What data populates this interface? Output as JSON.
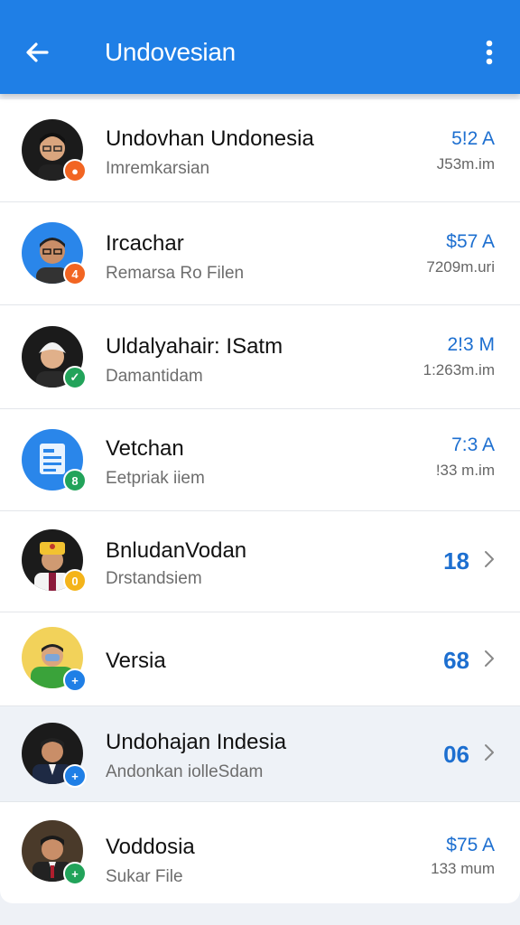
{
  "appbar": {
    "title": "Undovesian",
    "back_icon": "arrow-left-icon",
    "menu_icon": "more-vert-icon",
    "color": "#1f7fe6"
  },
  "items": [
    {
      "name": "Undovhan Undonesia",
      "subtitle": "Imremkarsian",
      "amount": "5!2 A",
      "time": "J53m.im",
      "badge_color": "#f26522",
      "badge_glyph": "●"
    },
    {
      "name": "Ircachar",
      "subtitle": "Remarsa Ro Filen",
      "amount": "$57 A",
      "time": "7209m.uri",
      "badge_color": "#f26522",
      "badge_glyph": "4"
    },
    {
      "name": "Uldalyahair: ISatm",
      "subtitle": "Damantidam",
      "amount": "2!3 M",
      "time": "1:263m.im",
      "badge_color": "#22a35a",
      "badge_glyph": "✓"
    },
    {
      "name": "Vetchan",
      "subtitle": "Eetpriak iiem",
      "amount": "7:3 A",
      "time": "!33 m.im",
      "badge_color": "#22a35a",
      "badge_glyph": "8"
    },
    {
      "name": "BnludanVodan",
      "subtitle": "Drstandsiem",
      "count": "18",
      "badge_color": "#f4b41a",
      "badge_glyph": "0"
    },
    {
      "name": "Versia",
      "count": "68",
      "badge_color": "#1f7fe6",
      "badge_glyph": "+"
    },
    {
      "name": "Undohajan Indesia",
      "subtitle": "Andonkan iolleSdam",
      "count": "06",
      "badge_color": "#1f7fe6",
      "badge_glyph": "+"
    },
    {
      "name": "Voddosia",
      "subtitle": "Sukar File",
      "amount": "$75 A",
      "time": "133 mum",
      "badge_color": "#22a35a",
      "badge_glyph": "+"
    }
  ]
}
